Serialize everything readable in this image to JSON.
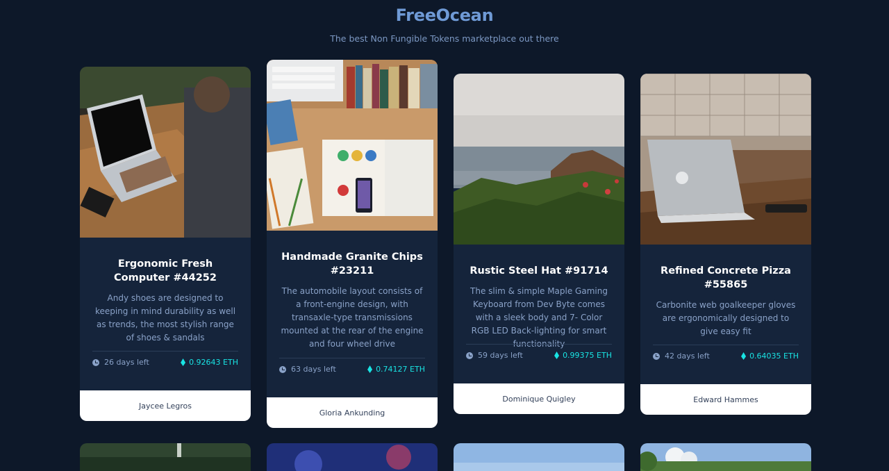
{
  "header": {
    "title": "FreeOcean",
    "subtitle": "The best Non Fungible Tokens marketplace out there"
  },
  "cards": [
    {
      "title": "Ergonomic Fresh Computer #44252",
      "description": "Andy shoes are designed to keeping in mind durability as well as trends, the most stylish range of shoes & sandals",
      "time_left": "26 days left",
      "price": "0.92643 ETH",
      "owner": "Jaycee Legros",
      "image": "man-laptop-photo"
    },
    {
      "title": "Handmade Granite Chips #23211",
      "description": "The automobile layout consists of a front-engine design, with transaxle-type transmissions mounted at the rear of the engine and four wheel drive",
      "time_left": "63 days left",
      "price": "0.74127 ETH",
      "owner": "Gloria Ankunding",
      "image": "desk-books-photo"
    },
    {
      "title": "Rustic Steel Hat #91714",
      "description": "The slim & simple Maple Gaming Keyboard from Dev Byte comes with a sleek body and 7- Color RGB LED Back-lighting for smart functionality",
      "time_left": "59 days left",
      "price": "0.99375 ETH",
      "owner": "Dominique Quigley",
      "image": "sea-coast-photo"
    },
    {
      "title": "Refined Concrete Pizza #55865",
      "description": "Carbonite web goalkeeper gloves are ergonomically designed to give easy fit",
      "time_left": "42 days left",
      "price": "0.64035 ETH",
      "owner": "Edward Hammes",
      "image": "laptop-kitchen-photo"
    }
  ],
  "colors": {
    "background": "#0d1829",
    "card": "#15243b",
    "accent": "#19e3e3",
    "title": "#6f9ad6"
  }
}
